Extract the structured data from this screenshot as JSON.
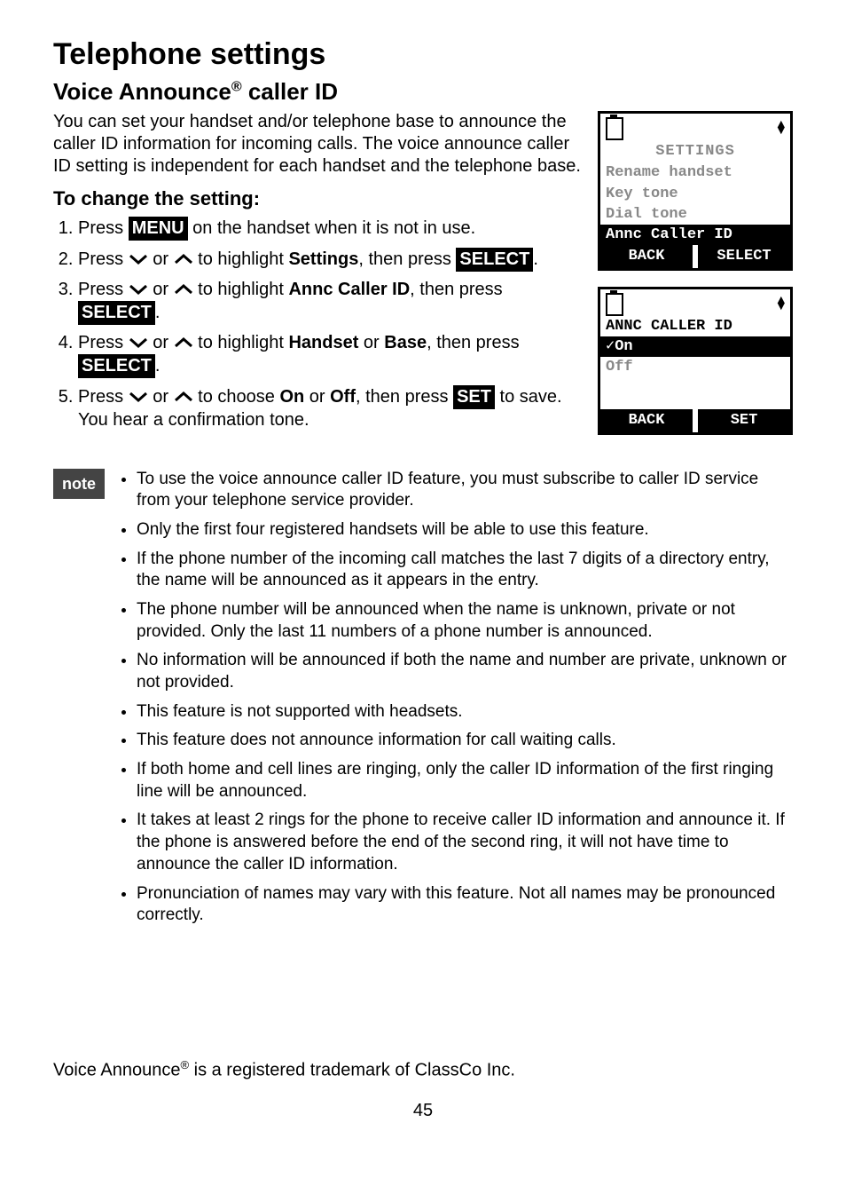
{
  "heading": "Telephone settings",
  "subheading_pre": "Voice Announce",
  "subheading_reg": "®",
  "subheading_post": " caller ID",
  "intro_paragraph": "You can set your handset and/or telephone base to announce the caller ID information for incoming calls. The voice announce caller ID setting is independent for each handset and the telephone base.",
  "to_change_heading": "To change the setting:",
  "buttons": {
    "menu": "MENU",
    "select": "SELECT",
    "set": "SET"
  },
  "steps": {
    "s1_pre": "Press ",
    "s1_post": " on the handset when it is not in use.",
    "s2_pre": "Press ",
    "s2_mid": " or ",
    "s2_mid2": " to highlight ",
    "s2_bold": "Settings",
    "s2_post": ", then press ",
    "s2_end": ".",
    "s3_pre": "Press ",
    "s3_mid": " or ",
    "s3_mid2": " to highlight ",
    "s3_bold": "Annc Caller ID",
    "s3_post": ", then press ",
    "s3_end": ".",
    "s4_pre": "Press ",
    "s4_mid": " or ",
    "s4_mid2": " to highlight ",
    "s4_bold1": "Handset",
    "s4_or": " or ",
    "s4_bold2": "Base",
    "s4_post": ", then press ",
    "s4_end": ".",
    "s5_pre": "Press ",
    "s5_mid": " or ",
    "s5_mid2": " to choose ",
    "s5_bold1": "On",
    "s5_or": " or ",
    "s5_bold2": "Off",
    "s5_post": ", then press ",
    "s5_end": " to save. You hear a confirmation tone."
  },
  "note_label": "note",
  "notes": [
    "To use the voice announce caller ID feature, you must subscribe to caller ID service from your telephone service provider.",
    "Only the first four registered handsets will be able to use this feature.",
    "If the phone number of the incoming call matches the last 7 digits of a directory entry, the name will be announced as it appears in the entry.",
    "The phone number will be announced when the name is unknown, private or not provided. Only the last 11 numbers of a phone number is announced.",
    "No information will be announced if both the name and number are private, unknown or not provided.",
    "This feature is not supported with headsets.",
    "This feature does not announce information for call waiting calls.",
    "If both home and cell lines are ringing, only the caller ID information of the first ringing line will be announced.",
    "It takes at least 2 rings for the phone to receive caller ID information and announce it. If the phone is answered before the end of the second ring, it will not have time to announce the caller ID information.",
    "Pronunciation of names may vary with this feature. Not all names may be pronounced correctly."
  ],
  "lcd1": {
    "title": "SETTINGS",
    "row1": "Rename handset",
    "row2": "Key tone",
    "row3": "Dial tone",
    "row4": "Annc Caller ID",
    "soft_left": "BACK",
    "soft_right": "SELECT"
  },
  "lcd2": {
    "title": "ANNC CALLER ID",
    "row1": "✓On",
    "row2": " Off",
    "soft_left": "BACK",
    "soft_right": "SET"
  },
  "trademark_pre": "Voice Announce",
  "trademark_reg": "®",
  "trademark_post": " is a registered trademark of ClassCo Inc.",
  "page_number": "45"
}
